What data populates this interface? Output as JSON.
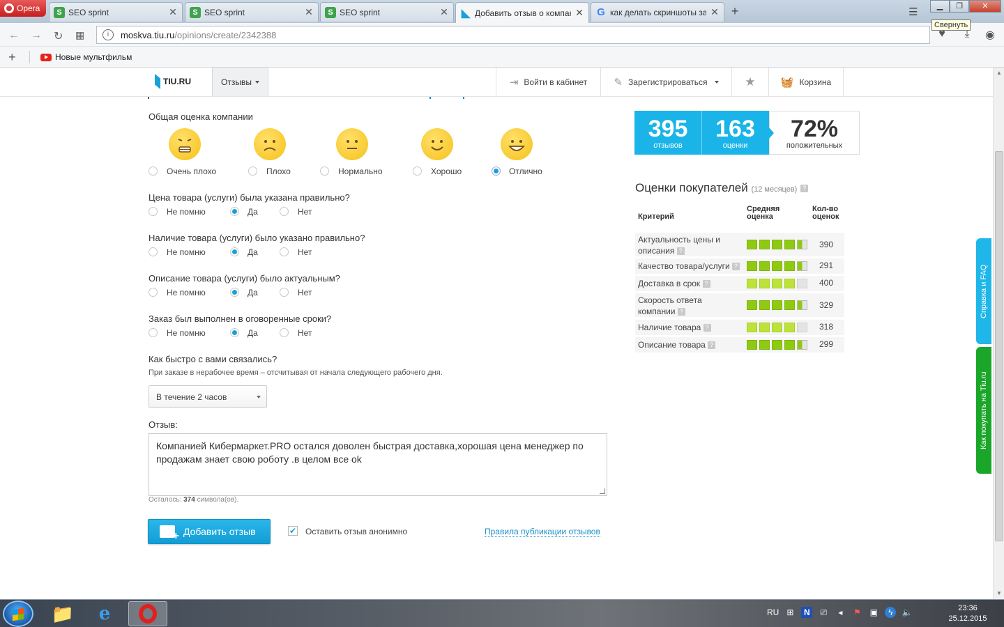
{
  "browser": {
    "app_name": "Opera",
    "tabs": [
      {
        "title": "SEO sprint",
        "icon": "S",
        "active": false
      },
      {
        "title": "SEO sprint",
        "icon": "S",
        "active": false
      },
      {
        "title": "SEO sprint",
        "icon": "S",
        "active": false
      },
      {
        "title": "Добавить отзыв о компан",
        "icon": "tiu",
        "active": true
      },
      {
        "title": "как делать скриншоты за",
        "icon": "G",
        "active": false
      }
    ],
    "new_tab": "+",
    "tooltip": "Свернуть",
    "url_host": "moskva.tiu.ru",
    "url_path": "/opinions/create/2342388",
    "bookmark": "Новые мультфильм",
    "bookmark_add": "+"
  },
  "site": {
    "logo": "TIU.RU",
    "nav_reviews": "Отзывы",
    "login": "Войти в кабинет",
    "register": "Зарегистрироваться",
    "cart": "Корзина"
  },
  "form": {
    "overall_title": "Общая оценка компании",
    "overall_options": [
      {
        "label": "Очень плохо",
        "face": "very-bad",
        "selected": false
      },
      {
        "label": "Плохо",
        "face": "bad",
        "selected": false
      },
      {
        "label": "Нормально",
        "face": "neutral",
        "selected": false
      },
      {
        "label": "Хорошо",
        "face": "good",
        "selected": false
      },
      {
        "label": "Отлично",
        "face": "excellent",
        "selected": true
      }
    ],
    "questions": [
      {
        "title": "Цена товара (услуги) была указана правильно?",
        "options": [
          "Не помню",
          "Да",
          "Нет"
        ],
        "selected": 1
      },
      {
        "title": "Наличие товара (услуги) было указано правильно?",
        "options": [
          "Не помню",
          "Да",
          "Нет"
        ],
        "selected": 1
      },
      {
        "title": "Описание товара (услуги) было актуальным?",
        "options": [
          "Не помню",
          "Да",
          "Нет"
        ],
        "selected": 1
      },
      {
        "title": "Заказ был выполнен в оговоренные сроки?",
        "options": [
          "Не помню",
          "Да",
          "Нет"
        ],
        "selected": 1
      }
    ],
    "contact_title": "Как быстро с вами связались?",
    "contact_hint": "При заказе в нерабочее время – отсчитывая от начала следующего рабочего дня.",
    "contact_value": "В течение 2 часов",
    "review_title": "Отзыв:",
    "review_text": "Компанией Кибермаркет.PRO остался доволен быстрая доставка,хорошая цена менеджер по продажам знает свою роботу .в целом все ok",
    "remaining_prefix": "Осталось:",
    "remaining_count": "374",
    "remaining_suffix": "символа(ов).",
    "submit_label": "Добавить отзыв",
    "anonymous_label": "Оставить отзыв анонимно",
    "anonymous_checked": true,
    "rules_link": "Правила публикации отзывов"
  },
  "stats": {
    "reviews_count": "395",
    "reviews_label": "отзывов",
    "ratings_count": "163",
    "ratings_label": "оценки",
    "positive_value": "72%",
    "positive_label": "положительных"
  },
  "ratings": {
    "title": "Оценки покупателей",
    "period": "(12 месяцев)",
    "col_criteria": "Критерий",
    "col_avg_1": "Средняя",
    "col_avg_2": "оценка",
    "col_count_1": "Кол-во",
    "col_count_2": "оценок",
    "rows": [
      {
        "lines": [
          "Актуальность цены и",
          "описания"
        ],
        "score_of_5": 4.5,
        "count": "390",
        "tone": "full"
      },
      {
        "lines": [
          "Качество товара/услуги"
        ],
        "score_of_5": 4.5,
        "count": "291",
        "tone": "full"
      },
      {
        "lines": [
          "Доставка в срок"
        ],
        "score_of_5": 4.0,
        "count": "400",
        "tone": "light"
      },
      {
        "lines": [
          "Скорость ответа",
          "компании"
        ],
        "score_of_5": 4.5,
        "count": "329",
        "tone": "full"
      },
      {
        "lines": [
          "Наличие товара"
        ],
        "score_of_5": 4.0,
        "count": "318",
        "tone": "light"
      },
      {
        "lines": [
          "Описание товара"
        ],
        "score_of_5": 4.5,
        "count": "299",
        "tone": "full"
      }
    ]
  },
  "side_tabs": {
    "help": "Справка и FAQ",
    "how_to_buy": "Как покупать на Tiu.ru"
  },
  "taskbar": {
    "lang": "RU",
    "time": "23:36",
    "date": "25.12.2015"
  },
  "colors": {
    "accent": "#1ab4e8",
    "link": "#1a8fc7",
    "rating_green": "#8fca12",
    "help_tab": "#1fb7e9",
    "buy_tab": "#1aa629"
  }
}
